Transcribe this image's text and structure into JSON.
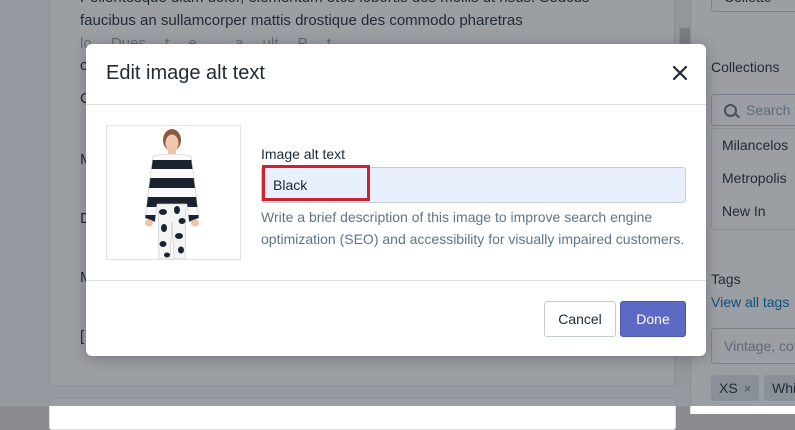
{
  "background": {
    "editor_lines": [
      "Pellentesque diam dolor, elementum etos lobortis des mollis ut risus. Sedcus",
      "faucibus an sullamcorper mattis drostique des commodo pharetras",
      "lo…  Dues…  t…  e…  …  a…  ult…  P…  t…",
      "c",
      "C",
      "M",
      "D",
      "M",
      "["
    ],
    "select_value": "Collette",
    "collections_label": "Collections",
    "search_placeholder": "Search f",
    "collection_options": [
      "Milancelos",
      "Metropolis",
      "New In"
    ],
    "tags_label": "Tags",
    "view_all_tags": "View all tags",
    "tags_placeholder": "Vintage, cot",
    "tags": [
      {
        "label": "XS",
        "remove": "×"
      },
      {
        "label": "Whi",
        "remove": ""
      }
    ]
  },
  "modal": {
    "title": "Edit image alt text",
    "close_icon": "close-icon",
    "image_alt": "Product photo of model in striped sweater and floral pants",
    "field_label": "Image alt text",
    "field_value": "Black",
    "help_text": "Write a brief description of this image to improve search engine optimization (SEO) and accessibility for visually impaired customers.",
    "cancel_label": "Cancel",
    "done_label": "Done"
  },
  "colors": {
    "primary": "#5c6ac4",
    "highlight": "#d0222e",
    "autofill": "#e8f0fe",
    "link": "#006fbb"
  }
}
